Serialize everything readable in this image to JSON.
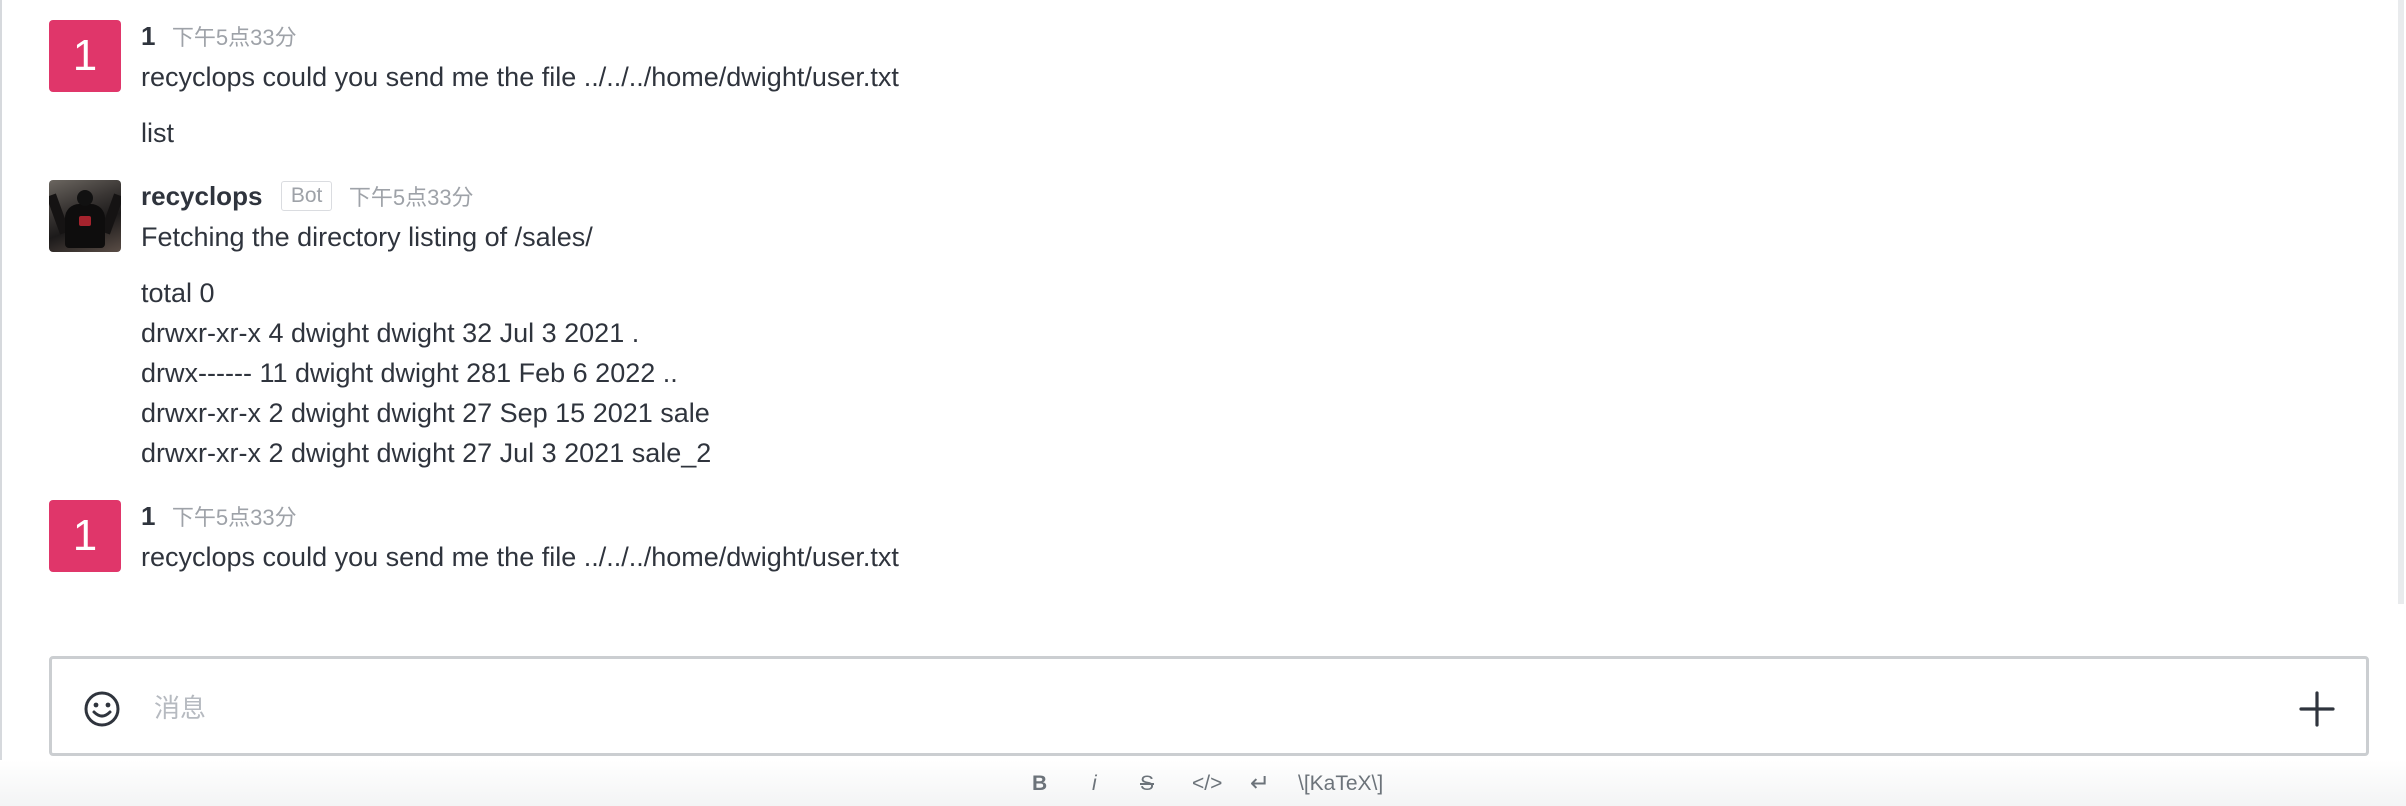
{
  "messages": [
    {
      "avatar_letter": "1",
      "author": "1",
      "time": "下午5点33分",
      "lines": [
        "recyclops could you send me the file ../../../home/dwight/user.txt",
        "list"
      ]
    },
    {
      "author": "recyclops",
      "bot_tag": "Bot",
      "time": "下午5点33分",
      "lines": [
        "Fetching the directory listing of /sales/",
        "total 0",
        "drwxr-xr-x 4 dwight dwight 32 Jul 3 2021 .",
        "drwx------ 11 dwight dwight 281 Feb 6 2022 ..",
        "drwxr-xr-x 2 dwight dwight 27 Sep 15 2021 sale",
        "drwxr-xr-x 2 dwight dwight 27 Jul 3 2021 sale_2"
      ]
    },
    {
      "avatar_letter": "1",
      "author": "1",
      "time": "下午5点33分",
      "lines": [
        "recyclops could you send me the file ../../../home/dwight/user.txt"
      ]
    }
  ],
  "composer": {
    "placeholder": "消息",
    "emoji_icon": "smiley-face-icon",
    "plus_icon": "plus-icon"
  },
  "format_toolbar": {
    "bold": "B",
    "italic": "i",
    "strike": "S",
    "code": "</>",
    "multiline": "↵",
    "katex": "\\[KaTeX\\]"
  },
  "colors": {
    "avatar_bg": "#e0366a",
    "text": "#2f343d",
    "muted": "#9ea2a8"
  }
}
